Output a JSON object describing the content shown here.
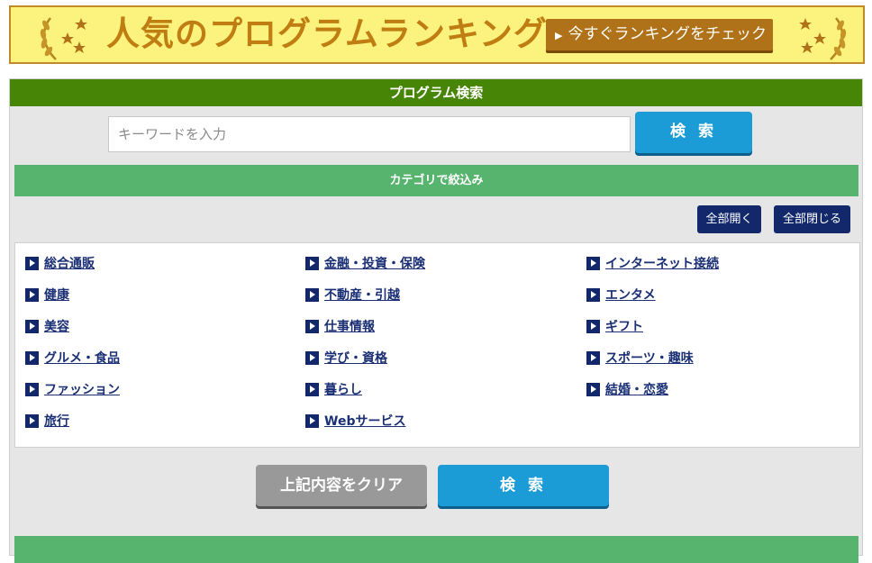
{
  "banner": {
    "title": "人気のプログラムランキング",
    "cta_label": "今すぐランキングをチェック",
    "colors": {
      "background": "#fbf37e",
      "accent": "#b07218",
      "border": "#c08a28"
    }
  },
  "search": {
    "header": "プログラム検索",
    "placeholder": "キーワードを入力",
    "button_label": "検 索"
  },
  "category": {
    "header": "カテゴリで絞込み",
    "expand_all": "全部開く",
    "collapse_all": "全部閉じる",
    "columns": [
      [
        "総合通販",
        "健康",
        "美容",
        "グルメ・食品",
        "ファッション",
        "旅行"
      ],
      [
        "金融・投資・保険",
        "不動産・引越",
        "仕事情報",
        "学び・資格",
        "暮らし",
        "Webサービス"
      ],
      [
        "インターネット接続",
        "エンタメ",
        "ギフト",
        "スポーツ・趣味",
        "結婚・恋愛"
      ]
    ]
  },
  "actions": {
    "clear_label": "上記内容をクリア",
    "search_label": "検 索"
  },
  "colors": {
    "panel_header": "#468506",
    "section_header": "#57b46e",
    "search_button": "#1b9cd6",
    "navy": "#12286b"
  }
}
